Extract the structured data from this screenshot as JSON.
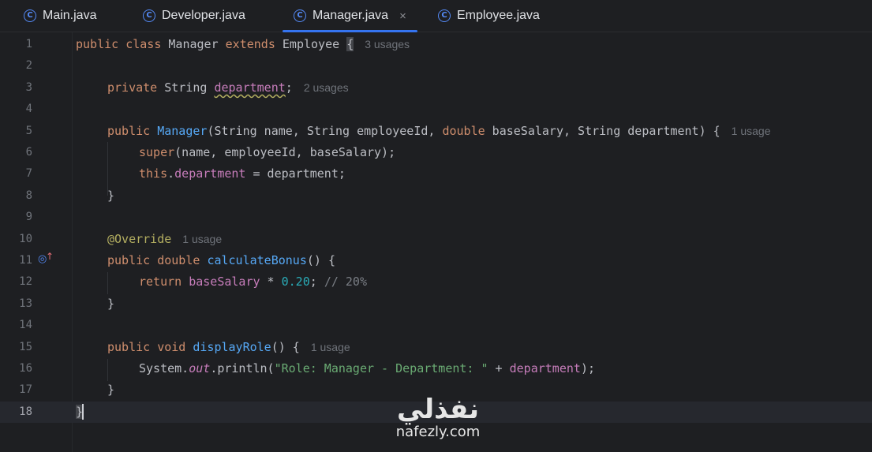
{
  "tabs": [
    {
      "label": "Main.java",
      "icon": "java-class-icon",
      "active": false
    },
    {
      "label": "Developer.java",
      "icon": "java-class-icon",
      "active": false
    },
    {
      "label": "Manager.java",
      "icon": "java-class-icon",
      "active": true
    },
    {
      "label": "Employee.java",
      "icon": "java-class-icon",
      "active": false
    }
  ],
  "tab_icon_glyph": "C",
  "close_glyph": "×",
  "line_numbers": [
    "1",
    "2",
    "3",
    "4",
    "5",
    "6",
    "7",
    "8",
    "9",
    "10",
    "11",
    "12",
    "13",
    "14",
    "15",
    "16",
    "17",
    "18"
  ],
  "current_line": "18",
  "code": {
    "l1": {
      "t1": "public",
      "t2": " ",
      "t3": "class",
      "t4": " Manager ",
      "t5": "extends",
      "t6": " Employee ",
      "t7": "{",
      "hint": "3 usages"
    },
    "l3": {
      "t1": "private",
      "t2": " String ",
      "t3": "department",
      "t4": ";",
      "hint": "2 usages"
    },
    "l5": {
      "t1": "public",
      "t2": " ",
      "t3": "Manager",
      "t4": "(String name, String employeeId, ",
      "t5": "double",
      "t6": " baseSalary, String department) {",
      "hint": "1 usage"
    },
    "l6": {
      "t1": "super",
      "t2": "(name, employeeId, baseSalary);"
    },
    "l7": {
      "t1": "this",
      "t2": ".",
      "t3": "department",
      "t4": " = department;"
    },
    "l8": {
      "t1": "}"
    },
    "l10": {
      "t1": "@Override",
      "hint": "1 usage"
    },
    "l11": {
      "t1": "public",
      "t2": " ",
      "t3": "double",
      "t4": " ",
      "t5": "calculateBonus",
      "t6": "() {"
    },
    "l12": {
      "t1": "return",
      "t2": " ",
      "t3": "baseSalary",
      "t4": " * ",
      "t5": "0.20",
      "t6": "; ",
      "t7": "// 20%"
    },
    "l13": {
      "t1": "}"
    },
    "l15": {
      "t1": "public",
      "t2": " ",
      "t3": "void",
      "t4": " ",
      "t5": "displayRole",
      "t6": "() {",
      "hint": "1 usage"
    },
    "l16": {
      "t1": "System.",
      "t2": "out",
      "t3": ".println(",
      "t4": "\"Role: Manager - Department: \"",
      "t5": " + ",
      "t6": "department",
      "t7": ");"
    },
    "l17": {
      "t1": "}"
    },
    "l18": {
      "t1": "}"
    }
  },
  "colors": {
    "background": "#1e1f22",
    "keyword": "#cf8e6d",
    "method": "#56a8f5",
    "field": "#c77dbb",
    "number": "#2aacb8",
    "string": "#6aab73",
    "comment": "#7a7e85",
    "annotation": "#b3ae60",
    "tab_accent": "#3574f0"
  },
  "gutter_icon": "override-method-icon",
  "watermark": {
    "arabic": "نفذلي",
    "latin": "nafezly.com"
  }
}
